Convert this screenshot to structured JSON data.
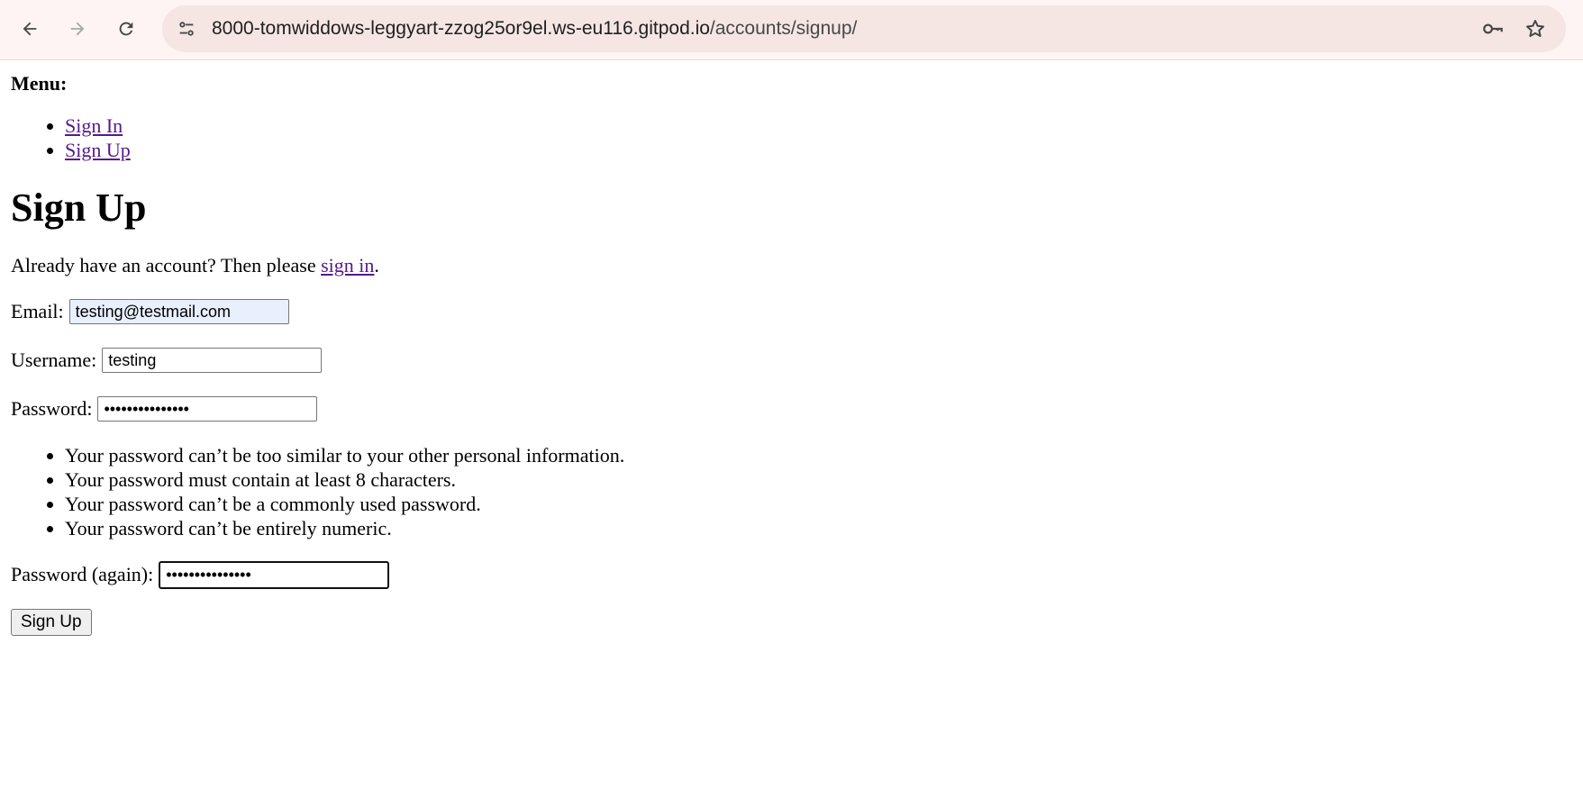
{
  "browser": {
    "url_host": "8000-tomwiddows-leggyart-zzog25or9el.ws-eu116.gitpod.io",
    "url_path": "/accounts/signup/",
    "icons": {
      "back": "back-arrow-icon",
      "forward": "forward-arrow-icon",
      "reload": "reload-icon",
      "site_info": "tune-icon",
      "password": "key-icon",
      "bookmark": "star-icon"
    }
  },
  "menu": {
    "title": "Menu:",
    "items": [
      {
        "label": "Sign In"
      },
      {
        "label": "Sign Up"
      }
    ]
  },
  "signup": {
    "heading": "Sign Up",
    "already_text": "Already have an account? Then please ",
    "signin_link": "sign in",
    "already_suffix": ".",
    "email": {
      "label": "Email:",
      "value": "testing@testmail.com"
    },
    "username": {
      "label": "Username:",
      "value": "testing"
    },
    "password": {
      "label": "Password:",
      "value": "•••••••••••••••"
    },
    "help": [
      "Your password can’t be too similar to your other personal information.",
      "Your password must contain at least 8 characters.",
      "Your password can’t be a commonly used password.",
      "Your password can’t be entirely numeric."
    ],
    "password2": {
      "label": "Password (again):",
      "value": "•••••••••••••••"
    },
    "submit_label": "Sign Up"
  }
}
